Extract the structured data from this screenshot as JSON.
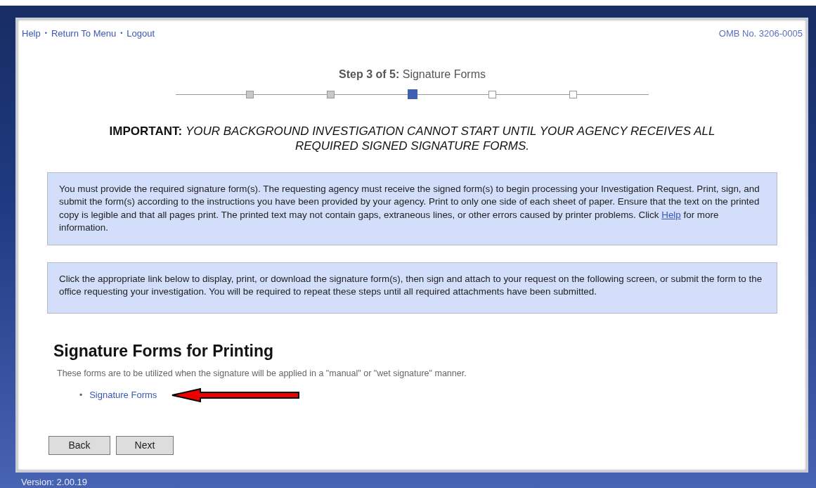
{
  "header": {
    "links": [
      {
        "label": "Help"
      },
      {
        "label": "Return To Menu"
      },
      {
        "label": "Logout"
      }
    ],
    "separators": [
      "•",
      "•"
    ],
    "omb": "OMB No. 3206-0005"
  },
  "step": {
    "label": "Step 3 of 5:",
    "title": "Signature Forms",
    "steps": [
      {
        "completed": true,
        "selected": false
      },
      {
        "completed": true,
        "selected": false
      },
      {
        "completed": false,
        "selected": true
      },
      {
        "completed": false,
        "selected": false
      },
      {
        "completed": false,
        "selected": false
      }
    ]
  },
  "important": "**IMPORTANT:** *YOUR BACKGROUND INVESTIGATION CANNOT START UNTIL YOUR AGENCY RECEIVES ALL REQUIRED SIGNED SIGNATURE FORMS.*",
  "notices": [
    {
      "text_before": "You must provide the required signature form(s). The requesting agency must receive the signed form(s) to begin processing your Investigation Request. Print, sign, and submit the form(s) according to the instructions you have been provided by your agency. Print to only one side of each sheet of paper. Ensure that the text on the printed copy is legible and that all pages print. The printed text may not contain gaps, extraneous lines, or other errors caused by printer problems. Click",
      "link": "Help",
      "text_after": "for more information."
    },
    {
      "text_before": "Click the appropriate link below to display, print, or download the signature form(s), then sign and attach to your request on the following screen, or submit the form to the office requesting your investigation. You will be required to repeat these steps until all required attachments have been submitted."
    }
  ],
  "section": {
    "title": "Signature Forms for Printing",
    "description": "These forms are to be utilized when the signature will be applied in a \"manual\" or \"wet signature\" manner.",
    "links": [
      {
        "bullet": "•",
        "label": "Signature Forms"
      }
    ]
  },
  "buttons": [
    "Back",
    "Next"
  ],
  "version": "Version: 2.00.19"
}
